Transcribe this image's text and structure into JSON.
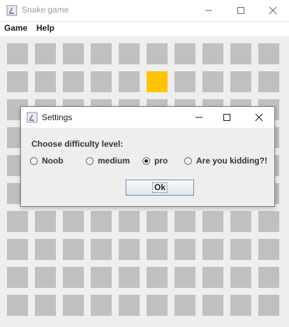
{
  "window": {
    "title": "Snake game"
  },
  "menu": {
    "items": [
      "Game",
      "Help"
    ]
  },
  "dialog": {
    "title": "Settings",
    "prompt": "Choose difficulty level:",
    "options": [
      {
        "label": "Noob",
        "selected": false
      },
      {
        "label": "medium",
        "selected": false
      },
      {
        "label": "pro",
        "selected": true
      },
      {
        "label": "Are you kidding?!",
        "selected": false
      }
    ],
    "ok_label": "Ok"
  },
  "board": {
    "columns": 10,
    "rows": 10,
    "food_cell": {
      "row": 1,
      "col": 5
    },
    "cell_color": "#c0c0c0",
    "food_color": "#ffc400"
  }
}
